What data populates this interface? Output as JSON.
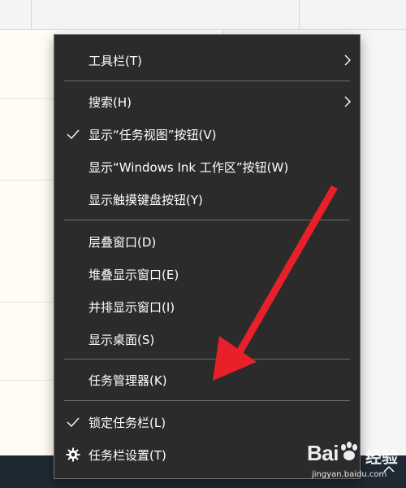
{
  "menu": {
    "items": [
      {
        "label": "工具栏(T)",
        "check": false,
        "submenu": true,
        "icon": null
      },
      {
        "label": "搜索(H)",
        "check": false,
        "submenu": true,
        "icon": null
      },
      {
        "label": "显示“任务视图”按钮(V)",
        "check": true,
        "submenu": false,
        "icon": "checkmark-icon"
      },
      {
        "label": "显示“Windows Ink 工作区”按钮(W)",
        "check": false,
        "submenu": false,
        "icon": null
      },
      {
        "label": "显示触摸键盘按钮(Y)",
        "check": false,
        "submenu": false,
        "icon": null
      },
      {
        "label": "层叠窗口(D)",
        "check": false,
        "submenu": false,
        "icon": null
      },
      {
        "label": "堆叠显示窗口(E)",
        "check": false,
        "submenu": false,
        "icon": null
      },
      {
        "label": "并排显示窗口(I)",
        "check": false,
        "submenu": false,
        "icon": null
      },
      {
        "label": "显示桌面(S)",
        "check": false,
        "submenu": false,
        "icon": null
      },
      {
        "label": "任务管理器(K)",
        "check": false,
        "submenu": false,
        "icon": null
      },
      {
        "label": "锁定任务栏(L)",
        "check": true,
        "submenu": false,
        "icon": "checkmark-icon"
      },
      {
        "label": "任务栏设置(T)",
        "check": false,
        "submenu": false,
        "icon": "gear-icon"
      }
    ]
  },
  "watermark": {
    "brand_left": "Bai",
    "brand_right": "经验",
    "site": "jingyan.baidu.com"
  },
  "colors": {
    "menu_bg": "#2b2b2b",
    "menu_text": "#ffffff",
    "separator": "#6a6a6a",
    "annotation": "#e8202a",
    "taskbar": "#1f2933"
  }
}
